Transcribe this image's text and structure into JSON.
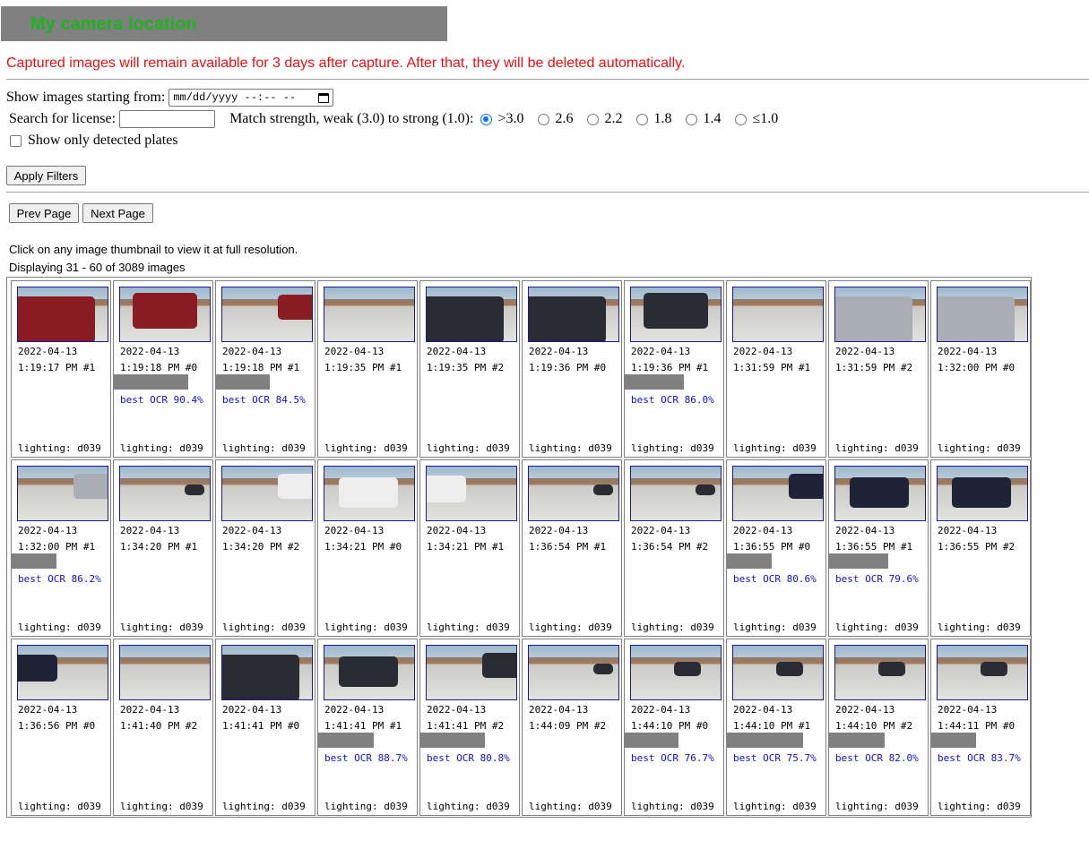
{
  "header": {
    "title": "My camera location"
  },
  "notice": "Captured images will remain available for 3 days after capture. After that, they will be deleted automatically.",
  "filters": {
    "start_label": "Show images starting from:",
    "start_value": "mm/dd/yyyy --:-- --",
    "license_label": "Search for license:",
    "license_value": "",
    "match_label": "Match strength, weak (3.0) to strong (1.0):",
    "match_options": [
      {
        "label": ">3.0",
        "selected": true
      },
      {
        "label": "2.6",
        "selected": false
      },
      {
        "label": "2.2",
        "selected": false
      },
      {
        "label": "1.8",
        "selected": false
      },
      {
        "label": "1.4",
        "selected": false
      },
      {
        "label": "≤1.0",
        "selected": false
      }
    ],
    "detected_only_label": "Show only detected plates",
    "detected_only_checked": false,
    "apply_label": "Apply Filters"
  },
  "pager": {
    "prev_label": "Prev Page",
    "next_label": "Next Page"
  },
  "info": {
    "click_hint": "Click on any image thumbnail to view it at full resolution.",
    "display_text": "Displaying 31 - 60 of 3089 images"
  },
  "images": [
    {
      "date": "2022-04-13",
      "time": "1:19:17 PM #1",
      "ocr": "",
      "lighting": "lighting: d039",
      "car": "red",
      "view": "close"
    },
    {
      "date": "2022-04-13",
      "time": "1:19:18 PM #0",
      "ocr": "best OCR 90.4%",
      "lighting": "lighting: d039",
      "car": "red",
      "view": "rear"
    },
    {
      "date": "2022-04-13",
      "time": "1:19:18 PM #1",
      "ocr": "best OCR 84.5%",
      "lighting": "lighting: d039",
      "car": "red",
      "view": "right"
    },
    {
      "date": "2022-04-13",
      "time": "1:19:35 PM #1",
      "ocr": "",
      "lighting": "lighting: d039",
      "car": "none",
      "view": "empty"
    },
    {
      "date": "2022-04-13",
      "time": "1:19:35 PM #2",
      "ocr": "",
      "lighting": "lighting: d039",
      "car": "dark",
      "view": "close"
    },
    {
      "date": "2022-04-13",
      "time": "1:19:36 PM #0",
      "ocr": "",
      "lighting": "lighting: d039",
      "car": "dark",
      "view": "close"
    },
    {
      "date": "2022-04-13",
      "time": "1:19:36 PM #1",
      "ocr": "best OCR 86.0%",
      "lighting": "lighting: d039",
      "car": "dark",
      "view": "rear"
    },
    {
      "date": "2022-04-13",
      "time": "1:31:59 PM #1",
      "ocr": "",
      "lighting": "lighting: d039",
      "car": "none",
      "view": "empty"
    },
    {
      "date": "2022-04-13",
      "time": "1:31:59 PM #2",
      "ocr": "",
      "lighting": "lighting: d039",
      "car": "silver",
      "view": "close"
    },
    {
      "date": "2022-04-13",
      "time": "1:32:00 PM #0",
      "ocr": "",
      "lighting": "lighting: d039",
      "car": "silver",
      "view": "close"
    },
    {
      "date": "2022-04-13",
      "time": "1:32:00 PM #1",
      "ocr": "best OCR 86.2%",
      "lighting": "lighting: d039",
      "car": "silver",
      "view": "right"
    },
    {
      "date": "2022-04-13",
      "time": "1:34:20 PM #1",
      "ocr": "",
      "lighting": "lighting: d039",
      "car": "dark",
      "view": "tiny"
    },
    {
      "date": "2022-04-13",
      "time": "1:34:20 PM #2",
      "ocr": "",
      "lighting": "lighting: d039",
      "car": "white",
      "view": "right"
    },
    {
      "date": "2022-04-13",
      "time": "1:34:21 PM #0",
      "ocr": "",
      "lighting": "lighting: d039",
      "car": "white",
      "view": "mid"
    },
    {
      "date": "2022-04-13",
      "time": "1:34:21 PM #1",
      "ocr": "",
      "lighting": "lighting: d039",
      "car": "white",
      "view": "left"
    },
    {
      "date": "2022-04-13",
      "time": "1:36:54 PM #1",
      "ocr": "",
      "lighting": "lighting: d039",
      "car": "dark",
      "view": "tiny"
    },
    {
      "date": "2022-04-13",
      "time": "1:36:54 PM #2",
      "ocr": "",
      "lighting": "lighting: d039",
      "car": "dark",
      "view": "tiny"
    },
    {
      "date": "2022-04-13",
      "time": "1:36:55 PM #0",
      "ocr": "best OCR 80.6%",
      "lighting": "lighting: d039",
      "car": "navy",
      "view": "right"
    },
    {
      "date": "2022-04-13",
      "time": "1:36:55 PM #1",
      "ocr": "best OCR 79.6%",
      "lighting": "lighting: d039",
      "car": "navy",
      "view": "mid"
    },
    {
      "date": "2022-04-13",
      "time": "1:36:55 PM #2",
      "ocr": "",
      "lighting": "lighting: d039",
      "car": "navy",
      "view": "mid"
    },
    {
      "date": "2022-04-13",
      "time": "1:36:56 PM #0",
      "ocr": "",
      "lighting": "lighting: d039",
      "car": "navy",
      "view": "left"
    },
    {
      "date": "2022-04-13",
      "time": "1:41:40 PM #2",
      "ocr": "",
      "lighting": "lighting: d039",
      "car": "none",
      "view": "empty"
    },
    {
      "date": "2022-04-13",
      "time": "1:41:41 PM #0",
      "ocr": "",
      "lighting": "lighting: d039",
      "car": "dark",
      "view": "close"
    },
    {
      "date": "2022-04-13",
      "time": "1:41:41 PM #1",
      "ocr": "best OCR 88.7%",
      "lighting": "lighting: d039",
      "car": "dark",
      "view": "mid"
    },
    {
      "date": "2022-04-13",
      "time": "1:41:41 PM #2",
      "ocr": "best OCR 80.8%",
      "lighting": "lighting: d039",
      "car": "dark",
      "view": "right"
    },
    {
      "date": "2022-04-13",
      "time": "1:44:09 PM #2",
      "ocr": "",
      "lighting": "lighting: d039",
      "car": "dark",
      "view": "tiny"
    },
    {
      "date": "2022-04-13",
      "time": "1:44:10 PM #0",
      "ocr": "best OCR 76.7%",
      "lighting": "lighting: d039",
      "car": "dark",
      "view": "small"
    },
    {
      "date": "2022-04-13",
      "time": "1:44:10 PM #1",
      "ocr": "best OCR 75.7%",
      "lighting": "lighting: d039",
      "car": "dark",
      "view": "small"
    },
    {
      "date": "2022-04-13",
      "time": "1:44:10 PM #2",
      "ocr": "best OCR 82.0%",
      "lighting": "lighting: d039",
      "car": "dark",
      "view": "small"
    },
    {
      "date": "2022-04-13",
      "time": "1:44:11 PM #0",
      "ocr": "best OCR 83.7%",
      "lighting": "lighting: d039",
      "car": "dark",
      "view": "small"
    }
  ]
}
